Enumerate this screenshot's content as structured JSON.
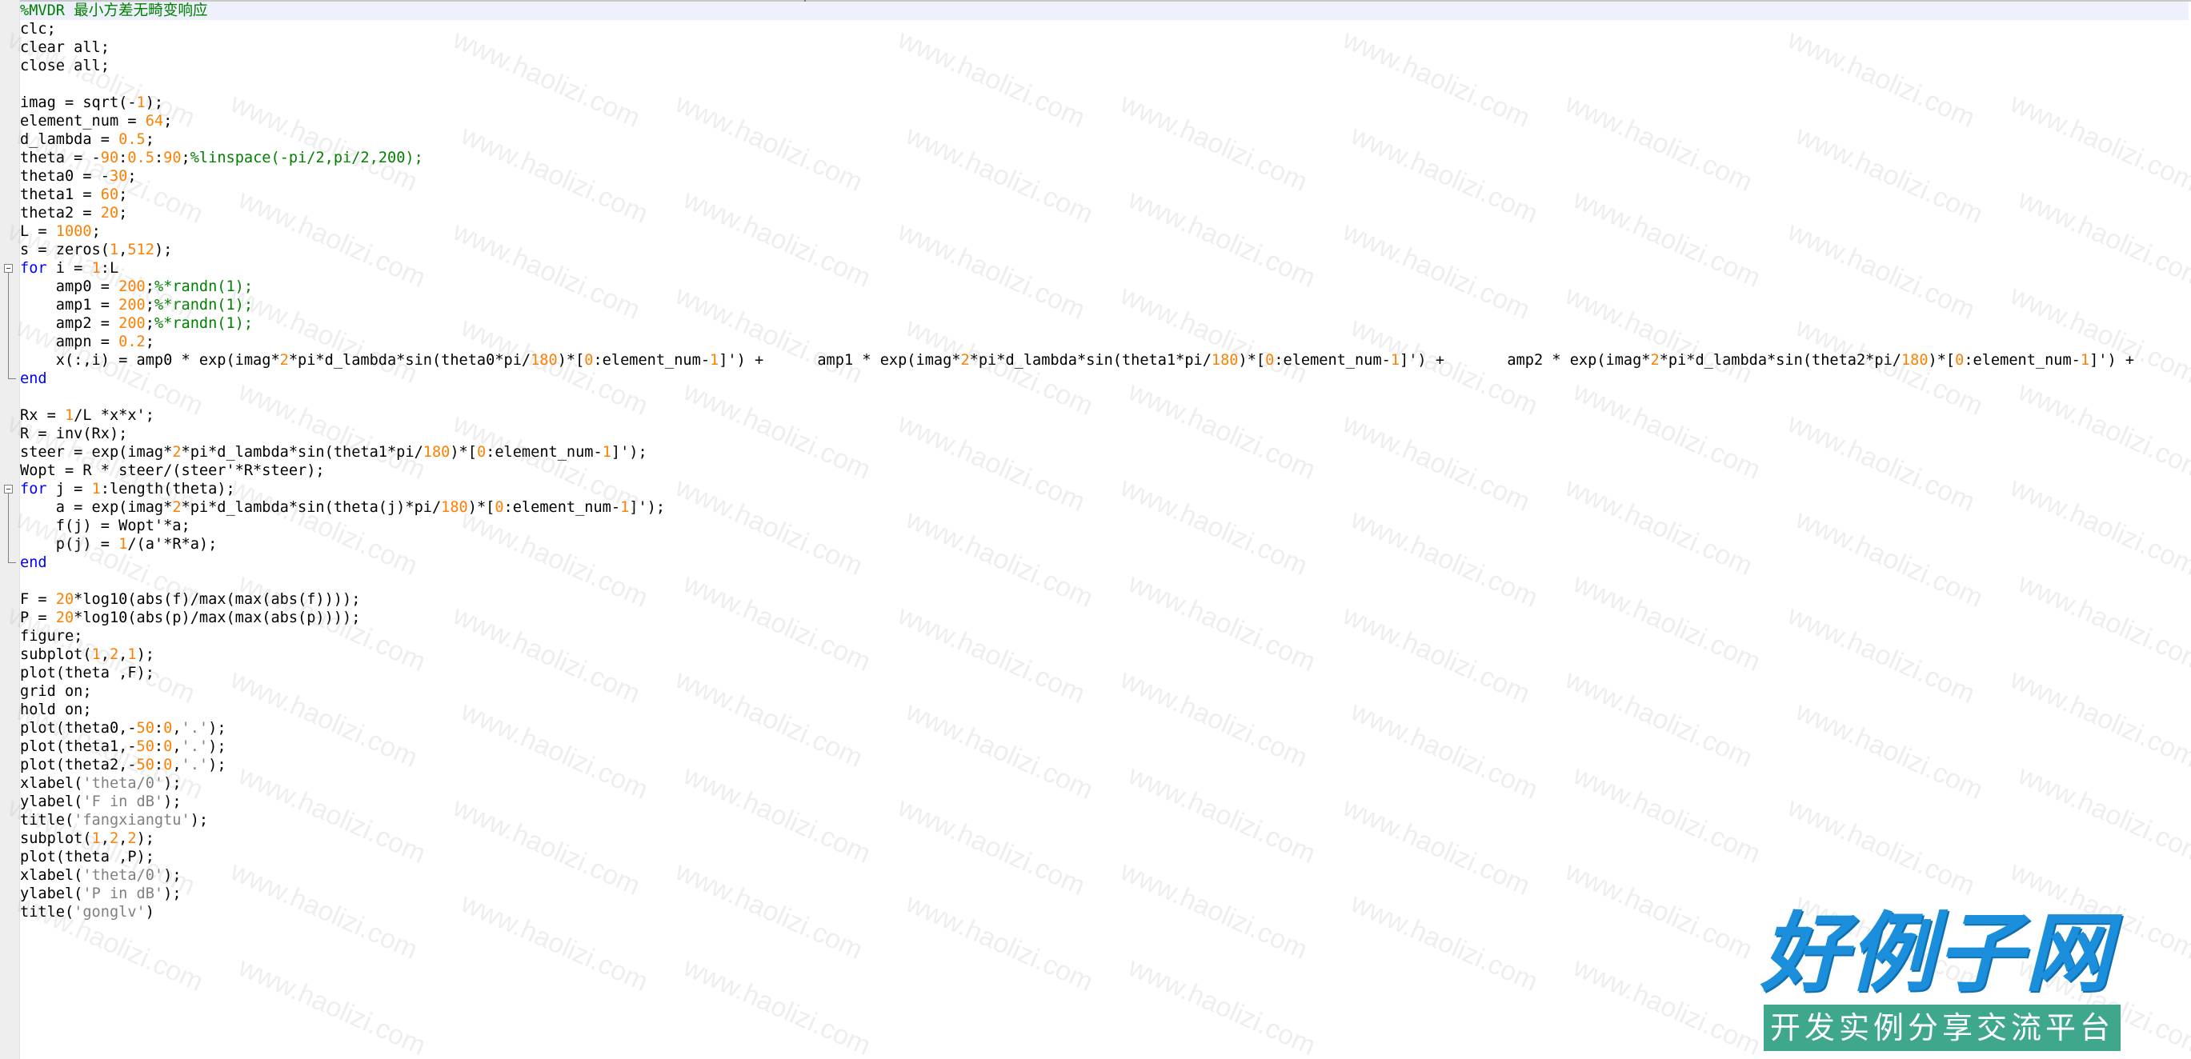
{
  "editor": {
    "language": "matlab",
    "code_lines": [
      "%MVDR 最小方差无畸变响应",
      "clc;",
      "clear all;",
      "close all;",
      "",
      "imag = sqrt(-1);",
      "element_num = 64;",
      "d_lambda = 0.5;",
      "theta = -90:0.5:90;%linspace(-pi/2,pi/2,200);",
      "theta0 = -30;",
      "theta1 = 60;",
      "theta2 = 20;",
      "L = 1000;",
      "s = zeros(1,512);",
      "for i = 1:L",
      "    amp0 = 200;%*randn(1);",
      "    amp1 = 200;%*randn(1);",
      "    amp2 = 200;%*randn(1);",
      "    ampn = 0.2;",
      "    x(:,i) = amp0 * exp(imag*2*pi*d_lambda*sin(theta0*pi/180)*[0:element_num-1]') +      amp1 * exp(imag*2*pi*d_lambda*sin(theta1*pi/180)*[0:element_num-1]') +       amp2 * exp(imag*2*pi*d_lambda*sin(theta2*pi/180)*[0:element_num-1]') +",
      "end",
      "",
      "Rx = 1/L *x*x';",
      "R = inv(Rx);",
      "steer = exp(imag*2*pi*d_lambda*sin(theta1*pi/180)*[0:element_num-1]');",
      "Wopt = R * steer/(steer'*R*steer);",
      "for j = 1:length(theta);",
      "    a = exp(imag*2*pi*d_lambda*sin(theta(j)*pi/180)*[0:element_num-1]');",
      "    f(j) = Wopt'*a;",
      "    p(j) = 1/(a'*R*a);",
      "end",
      "",
      "F = 20*log10(abs(f)/max(max(abs(f))));",
      "P = 20*log10(abs(p)/max(max(abs(p))));",
      "figure;",
      "subplot(1,2,1);",
      "plot(theta ,F);",
      "grid on;",
      "hold on;",
      "plot(theta0,-50:0,'.');",
      "plot(theta1,-50:0,'.');",
      "plot(theta2,-50:0,'.');",
      "xlabel('theta/0');",
      "ylabel('F in dB');",
      "title('fangxiangtu');",
      "subplot(1,2,2);",
      "plot(theta ,P);",
      "xlabel('theta/0');",
      "ylabel('P in dB');",
      "title('gonglv')"
    ],
    "fold_regions": [
      [
        14,
        20
      ],
      [
        26,
        30
      ]
    ],
    "colors": {
      "keyword": "#0000ff",
      "number": "#ff8000",
      "comment": "#008000",
      "string": "#808080",
      "text": "#000000",
      "first_line_highlight": "#eef0fb"
    }
  },
  "watermark": {
    "text": "www.haolizi.com"
  },
  "logo": {
    "title": "好例子网",
    "subtitle": "开发实例分享交流平台"
  }
}
